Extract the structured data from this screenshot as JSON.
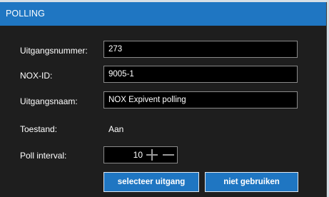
{
  "panel": {
    "title": "POLLING"
  },
  "fields": {
    "output_number": {
      "label": "Uitgangsnummer:",
      "value": "273"
    },
    "nox_id": {
      "label": "NOX-ID:",
      "value": "9005-1"
    },
    "output_name": {
      "label": "Uitgangsnaam:",
      "value": "NOX Expivent polling"
    },
    "state": {
      "label": "Toestand:",
      "value": "Aan"
    },
    "poll_interval": {
      "label": "Poll interval:",
      "value": "10",
      "plus_icon": "plus-icon",
      "minus_icon": "minus-icon"
    }
  },
  "buttons": {
    "select_label": "selecteer uitgang",
    "unuse_label": "niet gebruiken"
  },
  "colors": {
    "accent": "#1f76c2",
    "panel_bg": "#1e1e1e",
    "field_bg": "#000000",
    "page_bg": "#d6dfe6"
  }
}
